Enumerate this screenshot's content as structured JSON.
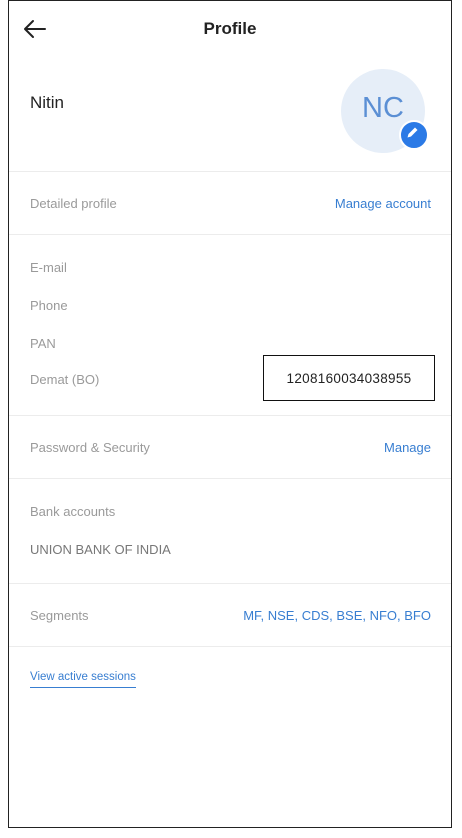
{
  "header": {
    "title": "Profile",
    "back_icon": "arrow-left-icon"
  },
  "user": {
    "name": "Nitin",
    "initials": "NC",
    "edit_icon": "pencil-icon"
  },
  "detailed_profile": {
    "label": "Detailed profile",
    "action": "Manage account"
  },
  "details": {
    "email_label": "E-mail",
    "phone_label": "Phone",
    "pan_label": "PAN",
    "demat_label": "Demat (BO)",
    "demat_value": "1208160034038955"
  },
  "security": {
    "label": "Password & Security",
    "action": "Manage"
  },
  "bank": {
    "label": "Bank accounts",
    "name": "UNION BANK OF INDIA"
  },
  "segments": {
    "label": "Segments",
    "value": "MF, NSE, CDS, BSE, NFO, BFO"
  },
  "sessions": {
    "link": "View active sessions"
  },
  "colors": {
    "accent": "#387ed1",
    "avatar_bg": "#e6eef8",
    "edit_badge": "#2b7ae6"
  }
}
